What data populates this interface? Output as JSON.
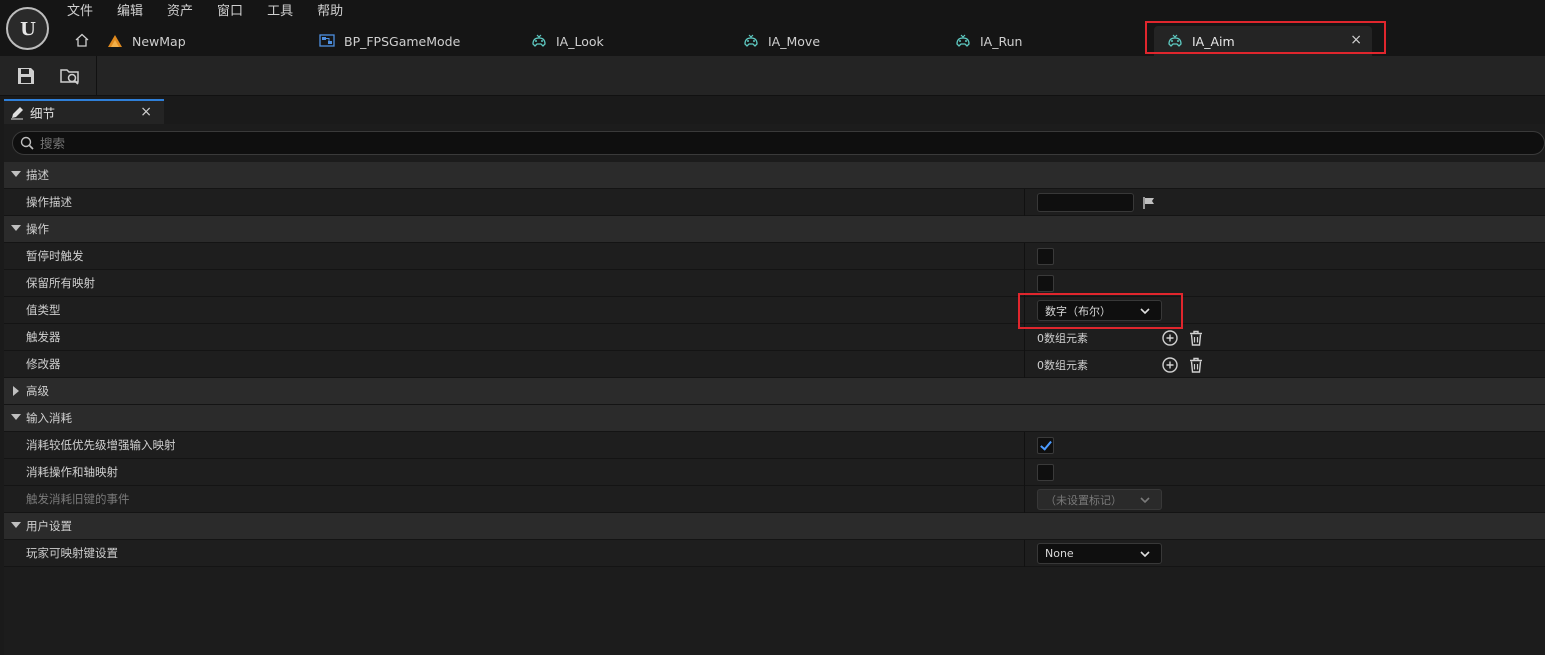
{
  "menu": [
    "文件",
    "编辑",
    "资产",
    "窗口",
    "工具",
    "帮助"
  ],
  "tabs": [
    {
      "label": "NewMap",
      "icon": "level-map-icon"
    },
    {
      "label": "BP_FPSGameMode",
      "icon": "blueprint-icon"
    },
    {
      "label": "IA_Look",
      "icon": "input-action-icon"
    },
    {
      "label": "IA_Move",
      "icon": "input-action-icon"
    },
    {
      "label": "IA_Run",
      "icon": "input-action-icon"
    },
    {
      "label": "IA_Aim",
      "icon": "input-action-icon",
      "active": true
    }
  ],
  "toolbar": {
    "save": "save-icon",
    "browse": "browse-asset-icon"
  },
  "panel": {
    "title": "细节",
    "close": "×"
  },
  "search": {
    "placeholder": "搜索"
  },
  "rows": {
    "desc_cat": "描述",
    "action_desc": "操作描述",
    "action_cat": "操作",
    "trigger_paused": "暂停时触发",
    "reserve_mappings": "保留所有映射",
    "value_type": "值类型",
    "value_type_value": "数字（布尔）",
    "triggers": "触发器",
    "triggers_value": "0数组元素",
    "modifiers": "修改器",
    "modifiers_value": "0数组元素",
    "advanced_cat": "高级",
    "input_consume_cat": "输入消耗",
    "consume_lower": "消耗较低优先级增强输入映射",
    "consume_legacy": "消耗操作和轴映射",
    "trigger_legacy_key": "触发消耗旧键的事件",
    "trigger_legacy_key_value": "（未设置标记）",
    "user_settings_cat": "用户设置",
    "player_mappable": "玩家可映射键设置",
    "player_mappable_value": "None"
  },
  "state": {
    "consume_lower_checked": true,
    "consume_legacy_checked": false,
    "trigger_paused_checked": false,
    "reserve_mappings_checked": false
  },
  "colors": {
    "highlight": "#e0262d",
    "accent": "#2f7fd8",
    "check": "#4c9bff"
  }
}
